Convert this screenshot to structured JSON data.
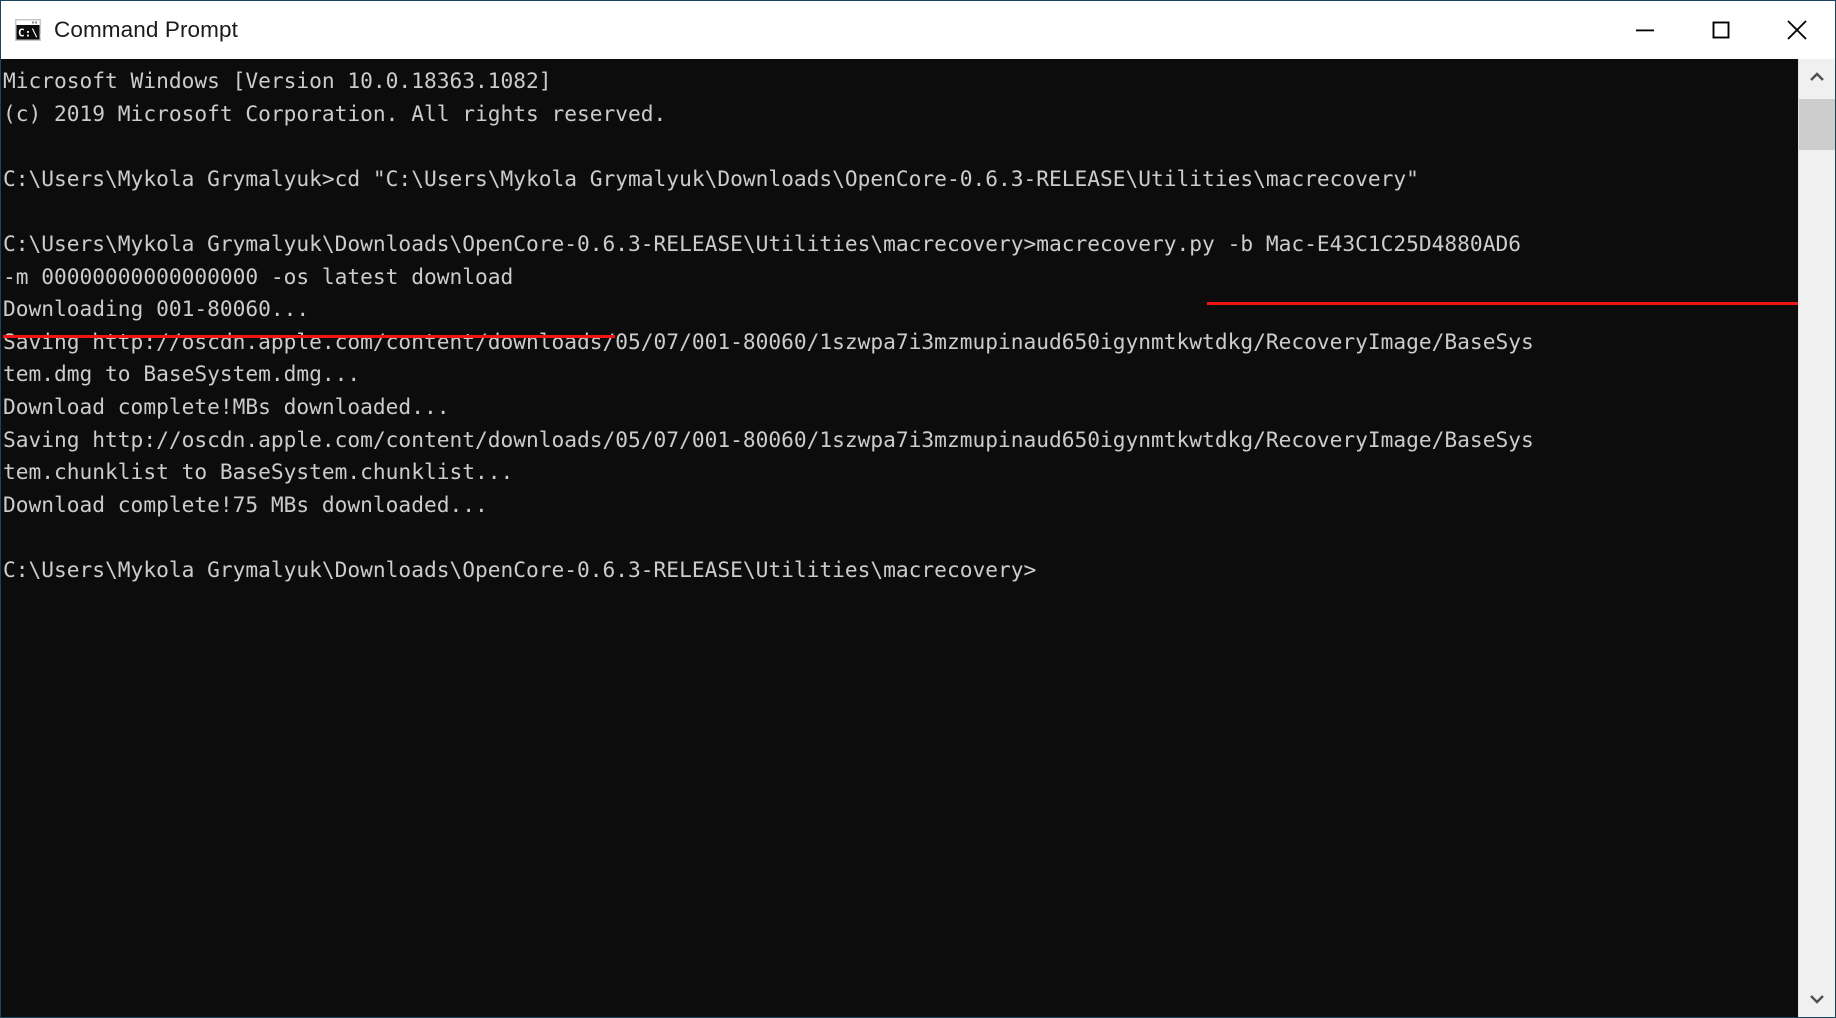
{
  "window": {
    "title": "Command Prompt",
    "icon": "cmd-console-icon",
    "border_color": "#17455e",
    "titlebar_bg": "#ffffff",
    "console_bg": "#0c0c0c",
    "console_fg": "#cccccc",
    "annotation_color": "#f01414"
  },
  "controls": {
    "minimize": "minimize-icon",
    "maximize": "maximize-icon",
    "close": "close-icon"
  },
  "scrollbar": {
    "up_arrow": "chevron-up-icon",
    "down_arrow": "chevron-down-icon"
  },
  "console": {
    "lines": [
      "Microsoft Windows [Version 10.0.18363.1082]",
      "(c) 2019 Microsoft Corporation. All rights reserved.",
      "",
      "C:\\Users\\Mykola Grymalyuk>cd \"C:\\Users\\Mykola Grymalyuk\\Downloads\\OpenCore-0.6.3-RELEASE\\Utilities\\macrecovery\"",
      "",
      "C:\\Users\\Mykola Grymalyuk\\Downloads\\OpenCore-0.6.3-RELEASE\\Utilities\\macrecovery>macrecovery.py -b Mac-E43C1C25D4880AD6",
      "-m 00000000000000000 -os latest download",
      "Downloading 001-80060...",
      "Saving http://oscdn.apple.com/content/downloads/05/07/001-80060/1szwpa7i3mzmupinaud650igynmtkwtdkg/RecoveryImage/BaseSys",
      "tem.dmg to BaseSystem.dmg...",
      "Download complete!MBs downloaded...",
      "Saving http://oscdn.apple.com/content/downloads/05/07/001-80060/1szwpa7i3mzmupinaud650igynmtkwtdkg/RecoveryImage/BaseSys",
      "tem.chunklist to BaseSystem.chunklist...",
      "Download complete!75 MBs downloaded...",
      "",
      "C:\\Users\\Mykola Grymalyuk\\Downloads\\OpenCore-0.6.3-RELEASE\\Utilities\\macrecovery>"
    ],
    "prompt_path": "C:\\Users\\Mykola Grymalyuk\\Downloads\\OpenCore-0.6.3-RELEASE\\Utilities\\macrecovery>",
    "command": "macrecovery.py -b Mac-E43C1C25D4880AD6 -m 00000000000000000 -os latest download",
    "board_id": "Mac-E43C1C25D4880AD6",
    "mlb": "00000000000000000",
    "os_version": "latest",
    "action": "download",
    "product_id": "001-80060",
    "download_host": "oscdn.apple.com",
    "download_hash": "1szwpa7i3mzmupinaud650igynmtkwtdkg",
    "downloaded_size": "75 MBs"
  }
}
